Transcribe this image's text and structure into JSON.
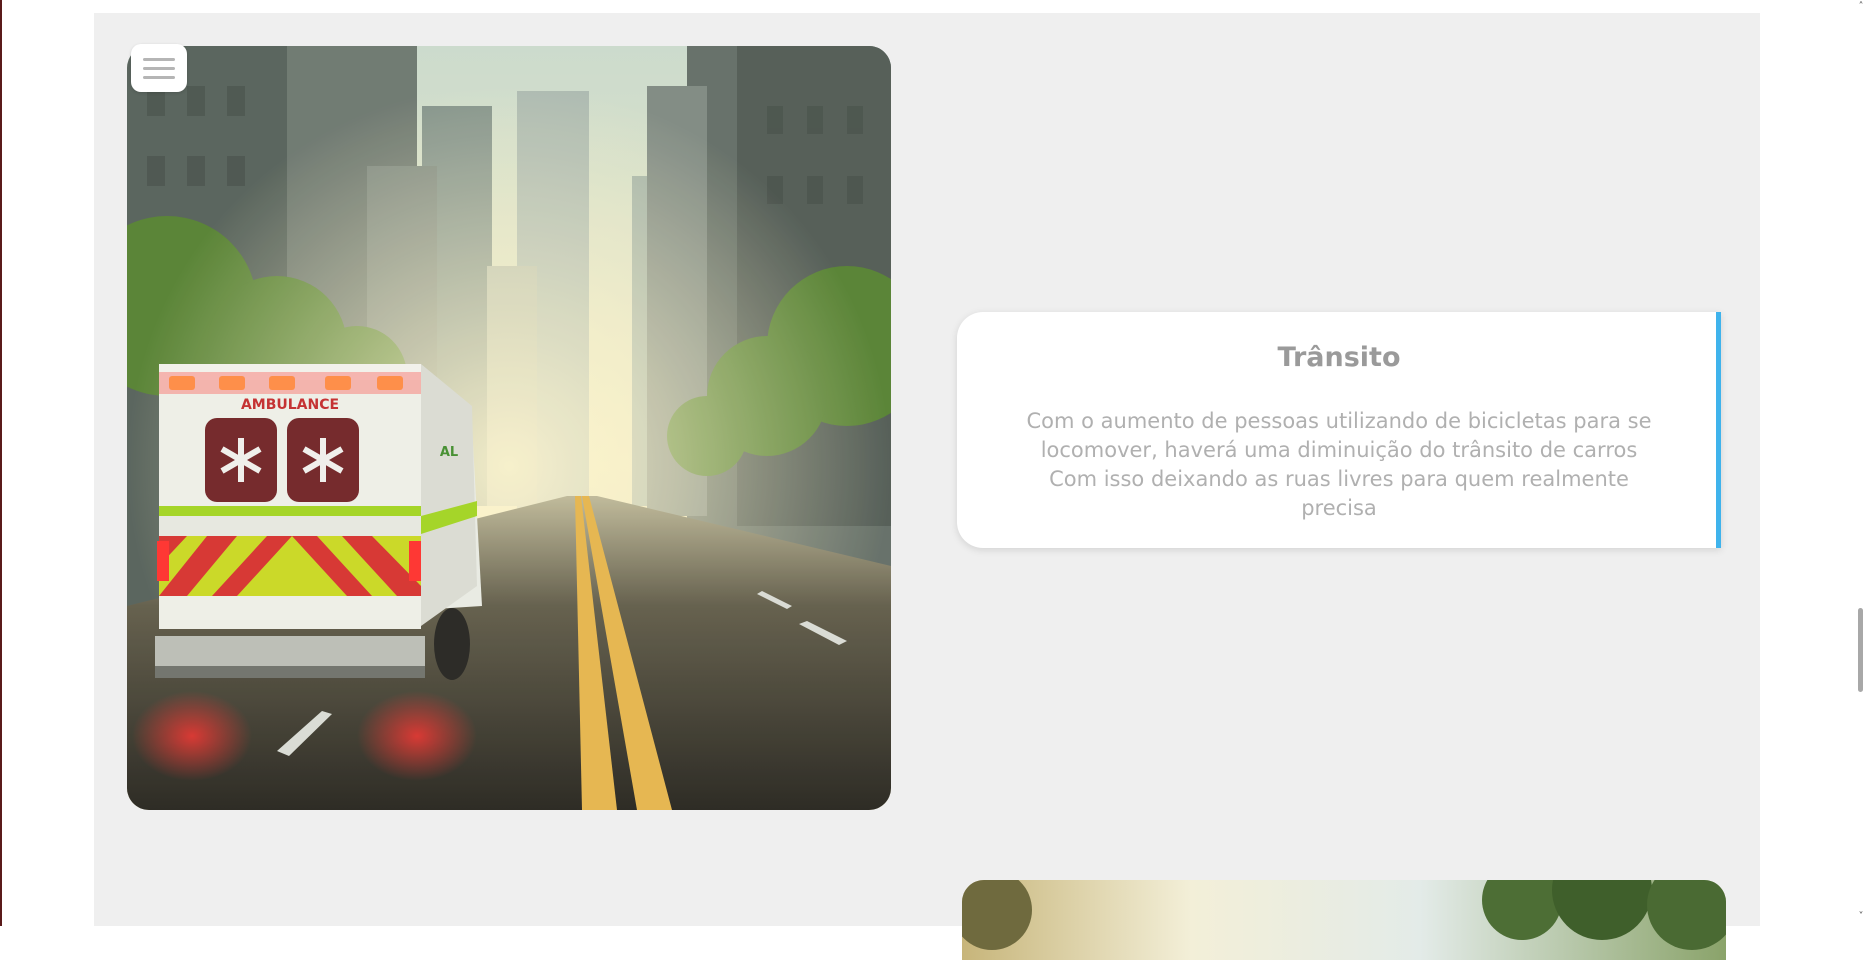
{
  "menu": {
    "icon": "hamburger-menu-icon"
  },
  "hero_image": {
    "description_icon": "ambulance-city-street-image",
    "badge_text": "AMBULANCE"
  },
  "info_card": {
    "title": "Trânsito",
    "text_lines": [
      "Com o aumento de pessoas utilizando de bicicletas para se",
      "locomover, haverá uma diminuição do trânsito de carros",
      "Com isso deixando as ruas livres para quem realmente",
      "precisa"
    ],
    "accent_color": "#3fb3ec"
  },
  "next_image": {
    "description_icon": "park-sunlight-image"
  },
  "scrollbar": {
    "up_glyph": "˄",
    "down_glyph": "˅"
  }
}
